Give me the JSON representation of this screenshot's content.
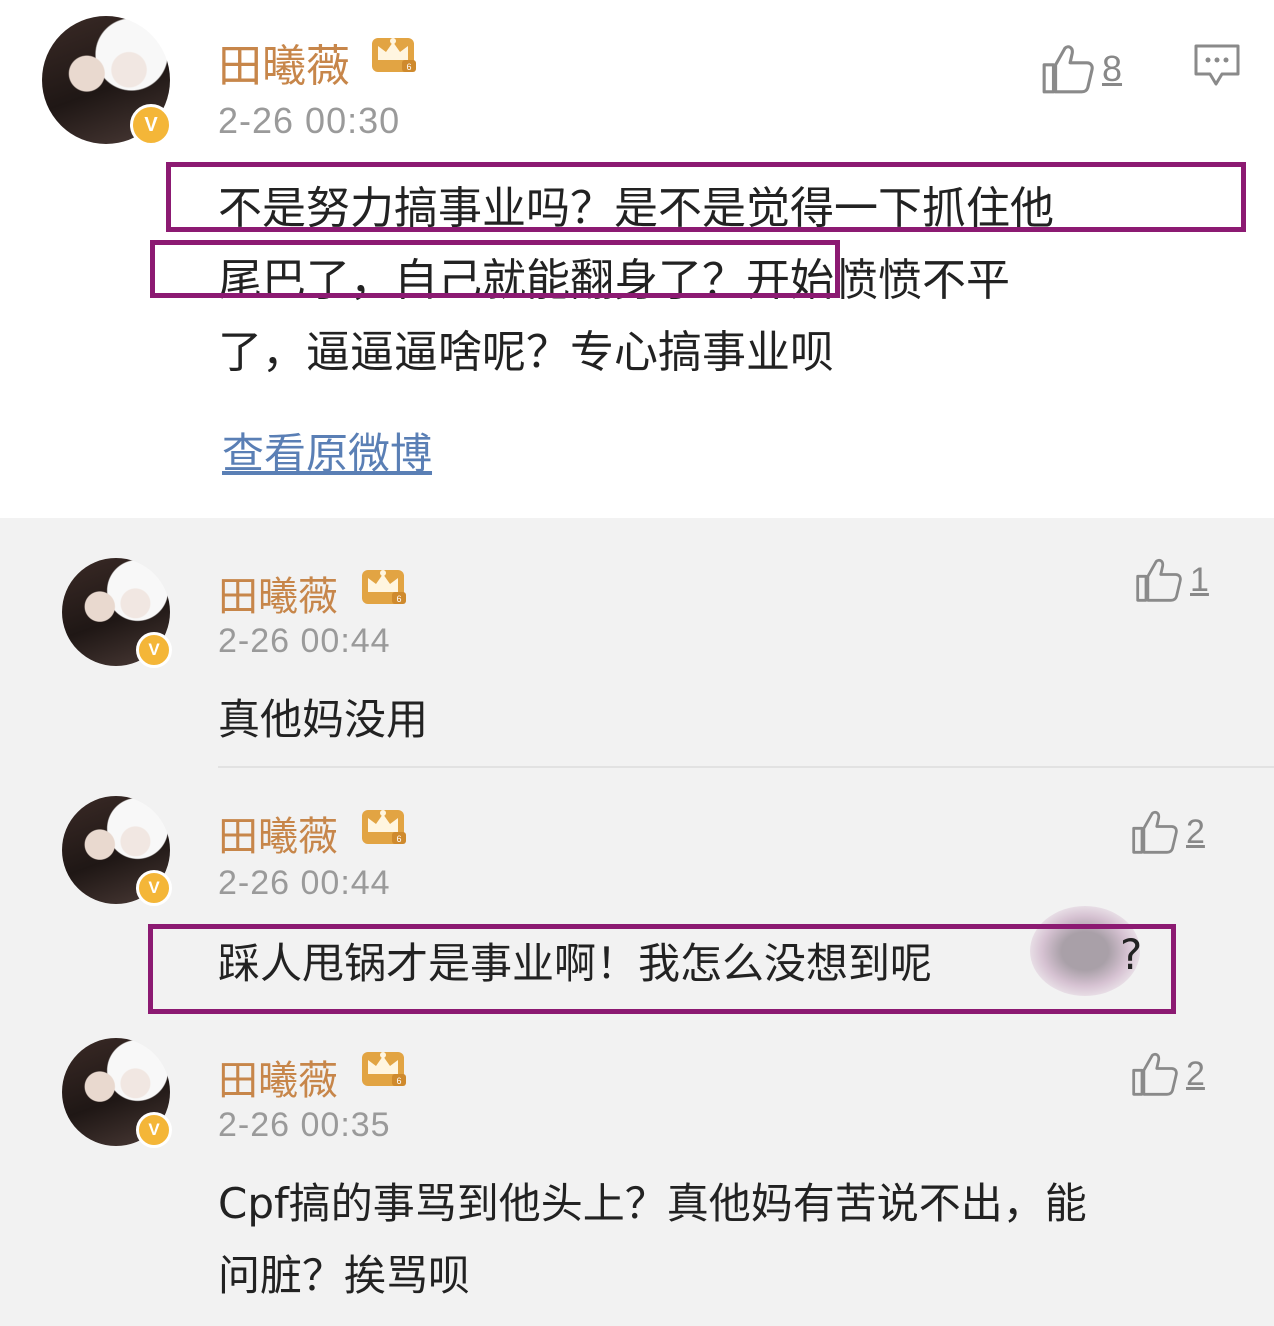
{
  "post": {
    "username": "田曦薇",
    "time": "2-26 00:30",
    "likes": "8",
    "text_lines": [
      "不是努力搞事业吗？是不是觉得一下抓住他",
      "尾巴了，自己就能翻身了？开始愤愤不平",
      "了，逼逼逼啥呢？专心搞事业呗"
    ],
    "view_original": "查看原微博"
  },
  "replies": [
    {
      "username": "田曦薇",
      "time": "2-26 00:44",
      "likes": "1",
      "text_lines": [
        "真他妈没用"
      ]
    },
    {
      "username": "田曦薇",
      "time": "2-26 00:44",
      "likes": "2",
      "text_lines": [
        "踩人甩锅才是事业啊！我怎么没想到呢",
        "?"
      ]
    },
    {
      "username": "田曦薇",
      "time": "2-26 00:35",
      "likes": "2",
      "text_lines": [
        "Cpf搞的事骂到他头上？真他妈有苦说不出，能",
        "问脏？挨骂呗"
      ]
    }
  ],
  "icons": {
    "like": "thumbs-up-icon",
    "comment": "comment-icon",
    "crown": "crown-badge-icon",
    "verified": "verified-v-icon"
  },
  "colors": {
    "username": "#c7864a",
    "highlight": "#8c1a72",
    "link": "#5a7fb5",
    "verified": "#f4b638"
  },
  "badge": {
    "v": "V"
  }
}
